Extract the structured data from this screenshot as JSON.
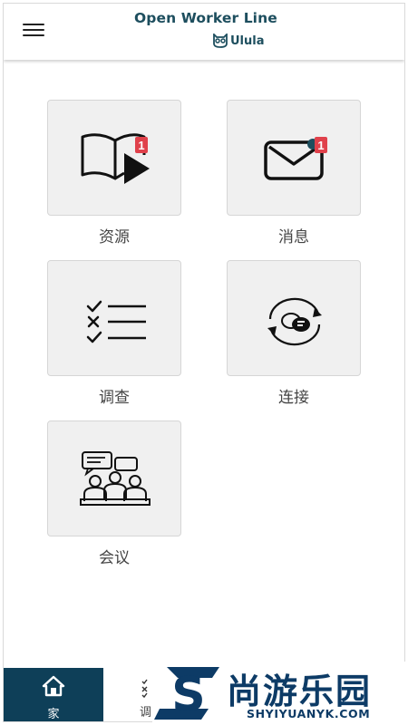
{
  "header": {
    "title": "Open Worker Line",
    "brand": "Ulula"
  },
  "tiles": [
    {
      "label": "资源",
      "badge": "1",
      "icon": "book-play-icon"
    },
    {
      "label": "消息",
      "badge": "1",
      "icon": "envelope-icon"
    },
    {
      "label": "调查",
      "icon": "checklist-icon"
    },
    {
      "label": "连接",
      "icon": "chat-sync-icon"
    },
    {
      "label": "会议",
      "icon": "meeting-icon"
    }
  ],
  "bottom_nav": {
    "home_label": "家",
    "survey_label": "调"
  },
  "watermark": {
    "title": "尚游乐园",
    "subtitle": "SHYIYUANYK.COM",
    "logo_letter": "S"
  },
  "colors": {
    "brand": "#1d4e5e",
    "nav_active": "#0e3f58",
    "badge": "#e0414b",
    "tile_bg": "#f0f0f0",
    "watermark": "#0d3b66"
  }
}
